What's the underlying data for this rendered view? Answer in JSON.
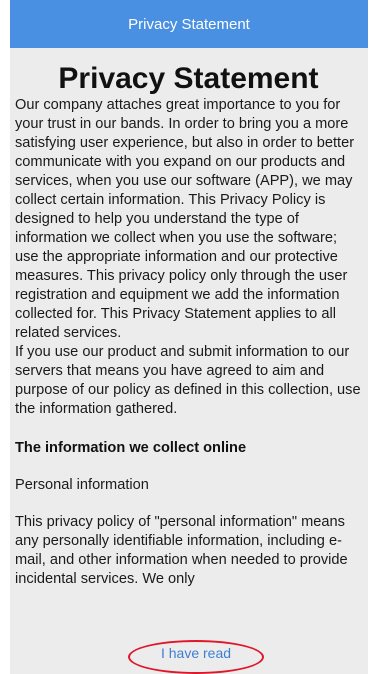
{
  "header": {
    "title": "Privacy Statement"
  },
  "document": {
    "title": "Privacy Statement",
    "intro": "Our company attaches great importance to you for your trust in our bands. In order to bring you a more satisfying user experience, but also in order to better communicate with you expand on our products and services, when you use our software (APP), we may collect certain information. This Privacy Policy is designed to help you understand the type of information we collect when you use the software; use the appropriate information and our protective measures. This privacy policy only through the user registration and equipment we add the information collected for. This Privacy Statement applies to all related services.",
    "consent": "If you use our product and submit information to our servers that means you have agreed to aim and purpose of our policy as defined in this collection, use the information gathered.",
    "section_heading": "The information we collect online",
    "sub_heading": "Personal information",
    "personal_info": "This privacy policy of \"personal information\" means any personally identifiable information, including e-mail, and other information when needed to provide incidental services. We only"
  },
  "footer": {
    "read_button_label": "I have read"
  },
  "colors": {
    "header_bg": "#4a90e2",
    "panel_bg": "#ececec",
    "link": "#3d7fd4",
    "annotation_circle": "#e0162b"
  }
}
